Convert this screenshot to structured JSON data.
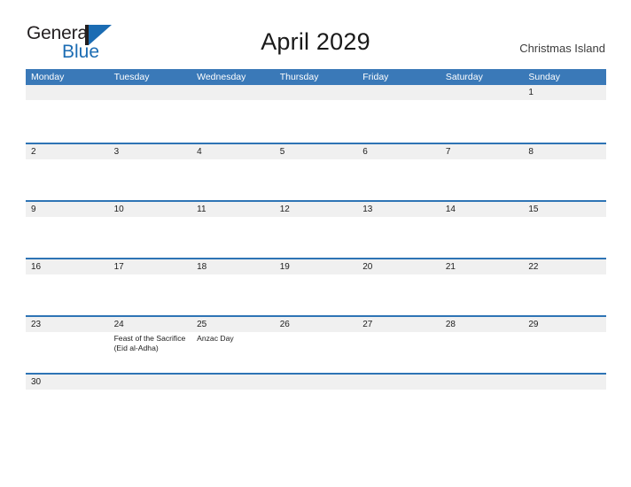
{
  "brand": {
    "name_top": "General",
    "name_bottom": "Blue",
    "mark_icon": "blue-flag-triangle-icon"
  },
  "header": {
    "title": "April 2029",
    "region": "Christmas Island"
  },
  "colors": {
    "header_blue": "#3a79b8",
    "row_rule_blue": "#2e74b5",
    "number_band_gray": "#f0f0f0",
    "brand_blue": "#1b6cb3",
    "text_dark": "#202020",
    "page_background": "#ffffff"
  },
  "calendar": {
    "weekdays": [
      "Monday",
      "Tuesday",
      "Wednesday",
      "Thursday",
      "Friday",
      "Saturday",
      "Sunday"
    ],
    "weeks": [
      {
        "days": [
          {
            "number": "",
            "events": []
          },
          {
            "number": "",
            "events": []
          },
          {
            "number": "",
            "events": []
          },
          {
            "number": "",
            "events": []
          },
          {
            "number": "",
            "events": []
          },
          {
            "number": "",
            "events": []
          },
          {
            "number": "1",
            "events": []
          }
        ]
      },
      {
        "days": [
          {
            "number": "2",
            "events": []
          },
          {
            "number": "3",
            "events": []
          },
          {
            "number": "4",
            "events": []
          },
          {
            "number": "5",
            "events": []
          },
          {
            "number": "6",
            "events": []
          },
          {
            "number": "7",
            "events": []
          },
          {
            "number": "8",
            "events": []
          }
        ]
      },
      {
        "days": [
          {
            "number": "9",
            "events": []
          },
          {
            "number": "10",
            "events": []
          },
          {
            "number": "11",
            "events": []
          },
          {
            "number": "12",
            "events": []
          },
          {
            "number": "13",
            "events": []
          },
          {
            "number": "14",
            "events": []
          },
          {
            "number": "15",
            "events": []
          }
        ]
      },
      {
        "days": [
          {
            "number": "16",
            "events": []
          },
          {
            "number": "17",
            "events": []
          },
          {
            "number": "18",
            "events": []
          },
          {
            "number": "19",
            "events": []
          },
          {
            "number": "20",
            "events": []
          },
          {
            "number": "21",
            "events": []
          },
          {
            "number": "22",
            "events": []
          }
        ]
      },
      {
        "days": [
          {
            "number": "23",
            "events": []
          },
          {
            "number": "24",
            "events": [
              "Feast of the Sacrifice (Eid al-Adha)"
            ]
          },
          {
            "number": "25",
            "events": [
              "Anzac Day"
            ]
          },
          {
            "number": "26",
            "events": []
          },
          {
            "number": "27",
            "events": []
          },
          {
            "number": "28",
            "events": []
          },
          {
            "number": "29",
            "events": []
          }
        ]
      },
      {
        "short": true,
        "days": [
          {
            "number": "30",
            "events": []
          },
          {
            "number": "",
            "events": []
          },
          {
            "number": "",
            "events": []
          },
          {
            "number": "",
            "events": []
          },
          {
            "number": "",
            "events": []
          },
          {
            "number": "",
            "events": []
          },
          {
            "number": "",
            "events": []
          }
        ]
      }
    ]
  }
}
